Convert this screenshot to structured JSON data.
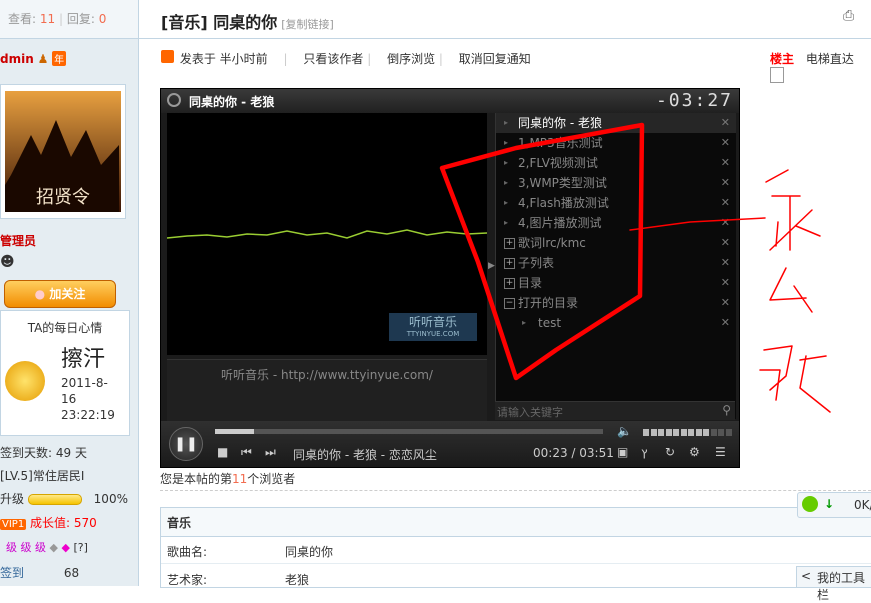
{
  "sidebar": {
    "views_label": "查看:",
    "views_count": "11",
    "replies_label": "回复:",
    "replies_count": "0",
    "username": "dmin",
    "year_badge": "年",
    "avatar_caption": "招贤令",
    "role": "管理员",
    "follow_button": "加关注",
    "mood_title": "TA的每日心情",
    "mood_word": "擦汗",
    "mood_date": "2011-8-16",
    "mood_time": "23:22:19",
    "sign_days": "签到天数: 49 天",
    "level": "[LV.5]常住居民I",
    "upgrade_label": "升级",
    "upgrade_percent": "100%",
    "vip_badge": "VIP1",
    "growth_label": "成长值: 570",
    "grade_text": "级 级 级",
    "grade_help": "[?]",
    "checkin_label": "签到",
    "checkin_value": "68"
  },
  "header": {
    "title": "[音乐] 同桌的你",
    "copy_link": "[复制链接]"
  },
  "post_bar": {
    "posted": "发表于 半小时前",
    "author_only": "只看该作者",
    "reverse": "倒序浏览",
    "cancel_notify": "取消回复通知",
    "floor": "楼主",
    "jump_label": "电梯直达"
  },
  "player": {
    "title": "同桌的你 - 老狼",
    "time_display": "-03:27",
    "watermark": "听听音乐",
    "watermark_url": "TTYINYUE.COM",
    "lyric_text": "听听音乐 - http://www.ttyinyue.com/",
    "search_placeholder": "请输入关键字",
    "now_playing": "同桌的你 - 老狼 - 恋恋风尘",
    "time": "00:23 / 03:51",
    "progress": 0.1,
    "volume": 0.75,
    "playlist": [
      {
        "label": "同桌的你 - 老狼",
        "active": true,
        "kind": "track"
      },
      {
        "label": "1,MP3音乐测试",
        "active": false,
        "kind": "track"
      },
      {
        "label": "2,FLV视频测试",
        "active": false,
        "kind": "track"
      },
      {
        "label": "3,WMP类型测试",
        "active": false,
        "kind": "track"
      },
      {
        "label": "4,Flash播放测试",
        "active": false,
        "kind": "track"
      },
      {
        "label": "4,图片播放测试",
        "active": false,
        "kind": "track"
      },
      {
        "label": "歌词lrc/kmc",
        "active": false,
        "kind": "folder"
      },
      {
        "label": "子列表",
        "active": false,
        "kind": "folder"
      },
      {
        "label": "目录",
        "active": false,
        "kind": "folder"
      },
      {
        "label": "打开的目录",
        "active": false,
        "kind": "open-folder"
      },
      {
        "label": "test",
        "active": false,
        "kind": "child"
      }
    ]
  },
  "viewer_line": {
    "prefix": "您是本帖的第",
    "count": "11",
    "suffix": "个浏览者"
  },
  "music_box": {
    "heading": "音乐",
    "song_label": "歌曲名:",
    "song_value": "同桌的你",
    "artist_label": "艺术家:",
    "artist_value": "老狼"
  },
  "widgets": {
    "speed": "0K/",
    "toolbar": "我的工具栏",
    "toolbar_arrow": "<"
  },
  "colors": {
    "accent": "#f26c4f",
    "ink": "#ff0000",
    "wave": "#9acd32"
  }
}
